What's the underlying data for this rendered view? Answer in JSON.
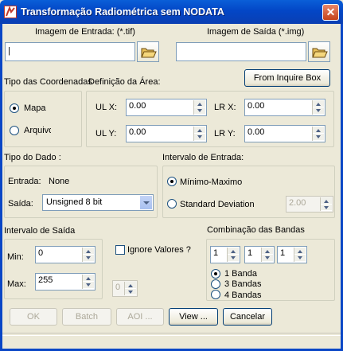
{
  "window": {
    "title": "Transformação Radiométrica sem NODATA",
    "close_glyph": "✕"
  },
  "input_image": {
    "label": "Imagem de Entrada: (*.tif)",
    "value": "|"
  },
  "output_image": {
    "label": "Imagem de Saída (*.img)",
    "value": ""
  },
  "from_inquire_box_label": "From Inquire Box",
  "coords": {
    "label": "Tipo das Coordenadas",
    "options": [
      {
        "label": "Mapa",
        "selected": true
      },
      {
        "label": "Arquivo",
        "selected": false
      }
    ]
  },
  "area": {
    "label": "Definição da Área:",
    "ulx": {
      "label": "UL X:",
      "value": "0.00"
    },
    "uly": {
      "label": "UL Y:",
      "value": "0.00"
    },
    "lrx": {
      "label": "LR X:",
      "value": "0.00"
    },
    "lry": {
      "label": "LR Y:",
      "value": "0.00"
    }
  },
  "data_type": {
    "label": "Tipo do Dado :",
    "input_label": "Entrada:",
    "input_value": "None",
    "output_label": "Saída:",
    "output_value": "Unsigned 8 bit"
  },
  "input_interval": {
    "label": "Intervalo de Entrada:",
    "options": [
      {
        "label": "Mínimo-Maximo",
        "selected": true
      },
      {
        "label": "Standard Deviation",
        "selected": false
      }
    ],
    "std_value": "2.00"
  },
  "output_interval": {
    "label": "Intervalo de Saída",
    "min_label": "Min:",
    "min_value": "0",
    "max_label": "Max:",
    "max_value": "255"
  },
  "ignore_values": {
    "label": "Ignore Valores ?",
    "checked": false,
    "value": "0"
  },
  "bands": {
    "label": "Combinação das  Bandas",
    "values": [
      "1",
      "1",
      "1"
    ],
    "options": [
      {
        "label": "1 Banda",
        "selected": true
      },
      {
        "label": "3 Bandas",
        "selected": false
      },
      {
        "label": "4 Bandas",
        "selected": false
      }
    ]
  },
  "buttons": {
    "ok": "OK",
    "batch": "Batch",
    "aoi": "AOI ...",
    "view": "View ...",
    "cancel": "Cancelar"
  }
}
